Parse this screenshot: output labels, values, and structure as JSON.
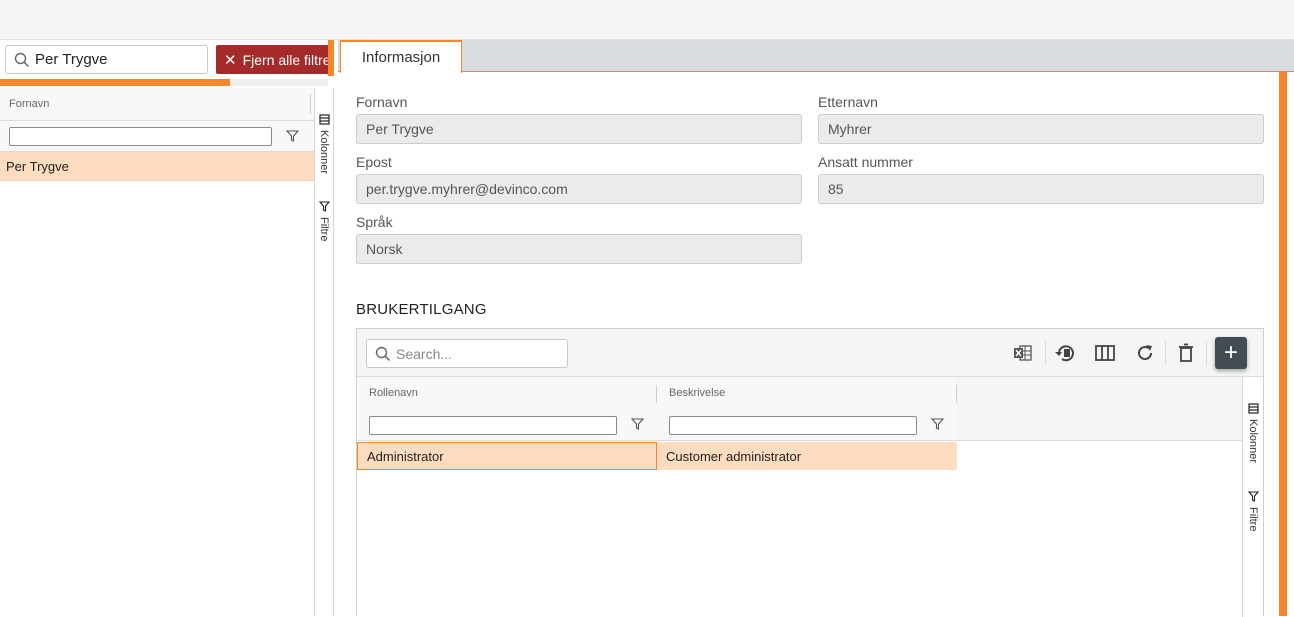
{
  "left_panel": {
    "search_value": "Per Trygve",
    "clear_filters_label": "Fjern alle filtre",
    "progress_percent": 70,
    "grid": {
      "column_header": "Fornavn",
      "rows": [
        "Per Trygve"
      ]
    },
    "side_rail": {
      "columns_label": "Kolonner",
      "filters_label": "Filtre"
    }
  },
  "right_panel": {
    "tab_label": "Informasjon",
    "fields": {
      "first_name_label": "Fornavn",
      "first_name_value": "Per Trygve",
      "last_name_label": "Etternavn",
      "last_name_value": "Myhrer",
      "email_label": "Epost",
      "email_value": "per.trygve.myhrer@devinco.com",
      "employee_number_label": "Ansatt nummer",
      "employee_number_value": "85",
      "language_label": "Språk",
      "language_value": "Norsk"
    },
    "access_section": {
      "title": "BRUKERTILGANG",
      "search_placeholder": "Search...",
      "columns": [
        "Rollenavn",
        "Beskrivelse"
      ],
      "rows": [
        {
          "role": "Administrator",
          "description": "Customer administrator"
        }
      ],
      "side_rail": {
        "columns_label": "Kolonner",
        "filters_label": "Filtre"
      }
    }
  },
  "colors": {
    "accent": "#f5862a",
    "danger": "#a52a2a",
    "selected_row": "#fddcbf",
    "add_button": "#444d56"
  }
}
